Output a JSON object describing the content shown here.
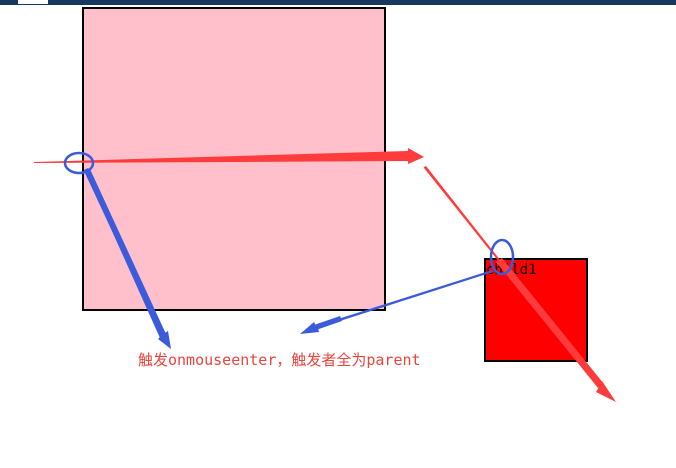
{
  "child_label": "child1",
  "caption": "触发onmouseenter，触发者全为parent",
  "colors": {
    "parent_fill": "#ffc0cb",
    "child_fill": "#ff0000",
    "red_arrow": "#ff3b3b",
    "blue_arrow": "#3b5bdb",
    "caption_text": "#e8453c",
    "top_bar": "#17375e"
  },
  "icons": [
    "red-arrow-icon",
    "blue-arrow-icon",
    "highlight-circle-icon"
  ]
}
